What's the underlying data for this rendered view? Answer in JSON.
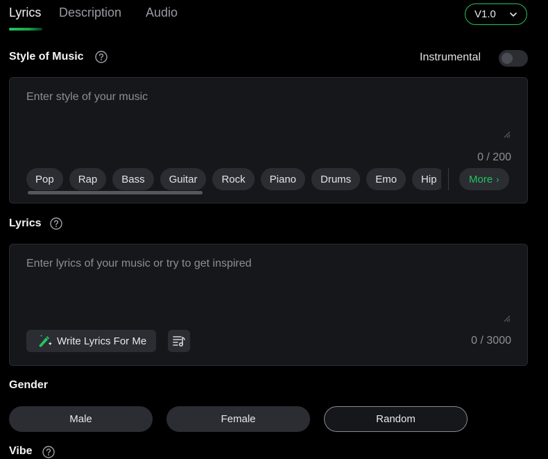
{
  "tabs": [
    {
      "label": "Lyrics",
      "active": true
    },
    {
      "label": "Description",
      "active": false
    },
    {
      "label": "Audio",
      "active": false
    }
  ],
  "version": {
    "selected": "V1.0"
  },
  "style_section": {
    "title": "Style of Music",
    "instrumental_label": "Instrumental",
    "instrumental_on": false,
    "placeholder": "Enter style of your music",
    "value": "",
    "counter": "0 / 200",
    "chips": [
      "Pop",
      "Rap",
      "Bass",
      "Guitar",
      "Rock",
      "Piano",
      "Drums",
      "Emo",
      "Hip"
    ],
    "more_label": "More"
  },
  "lyrics_section": {
    "title": "Lyrics",
    "placeholder": "Enter lyrics of your music or try to get inspired",
    "value": "",
    "counter": "0 / 3000",
    "write_button_label": "Write Lyrics For Me"
  },
  "gender_section": {
    "title": "Gender",
    "options": [
      {
        "label": "Male",
        "selected": false
      },
      {
        "label": "Female",
        "selected": false
      },
      {
        "label": "Random",
        "selected": true
      }
    ]
  },
  "vibe_section": {
    "title": "Vibe"
  },
  "colors": {
    "accent": "#22c55e",
    "panel": "#16171b",
    "chip": "#2b2d33",
    "background": "#000000"
  },
  "icons": {
    "help": "question-circle-icon",
    "version_chevron": "chevron-down-icon",
    "more_chevron": "chevron-right-icon",
    "write": "magic-pen-icon",
    "lyrics_tool": "music-list-icon"
  }
}
